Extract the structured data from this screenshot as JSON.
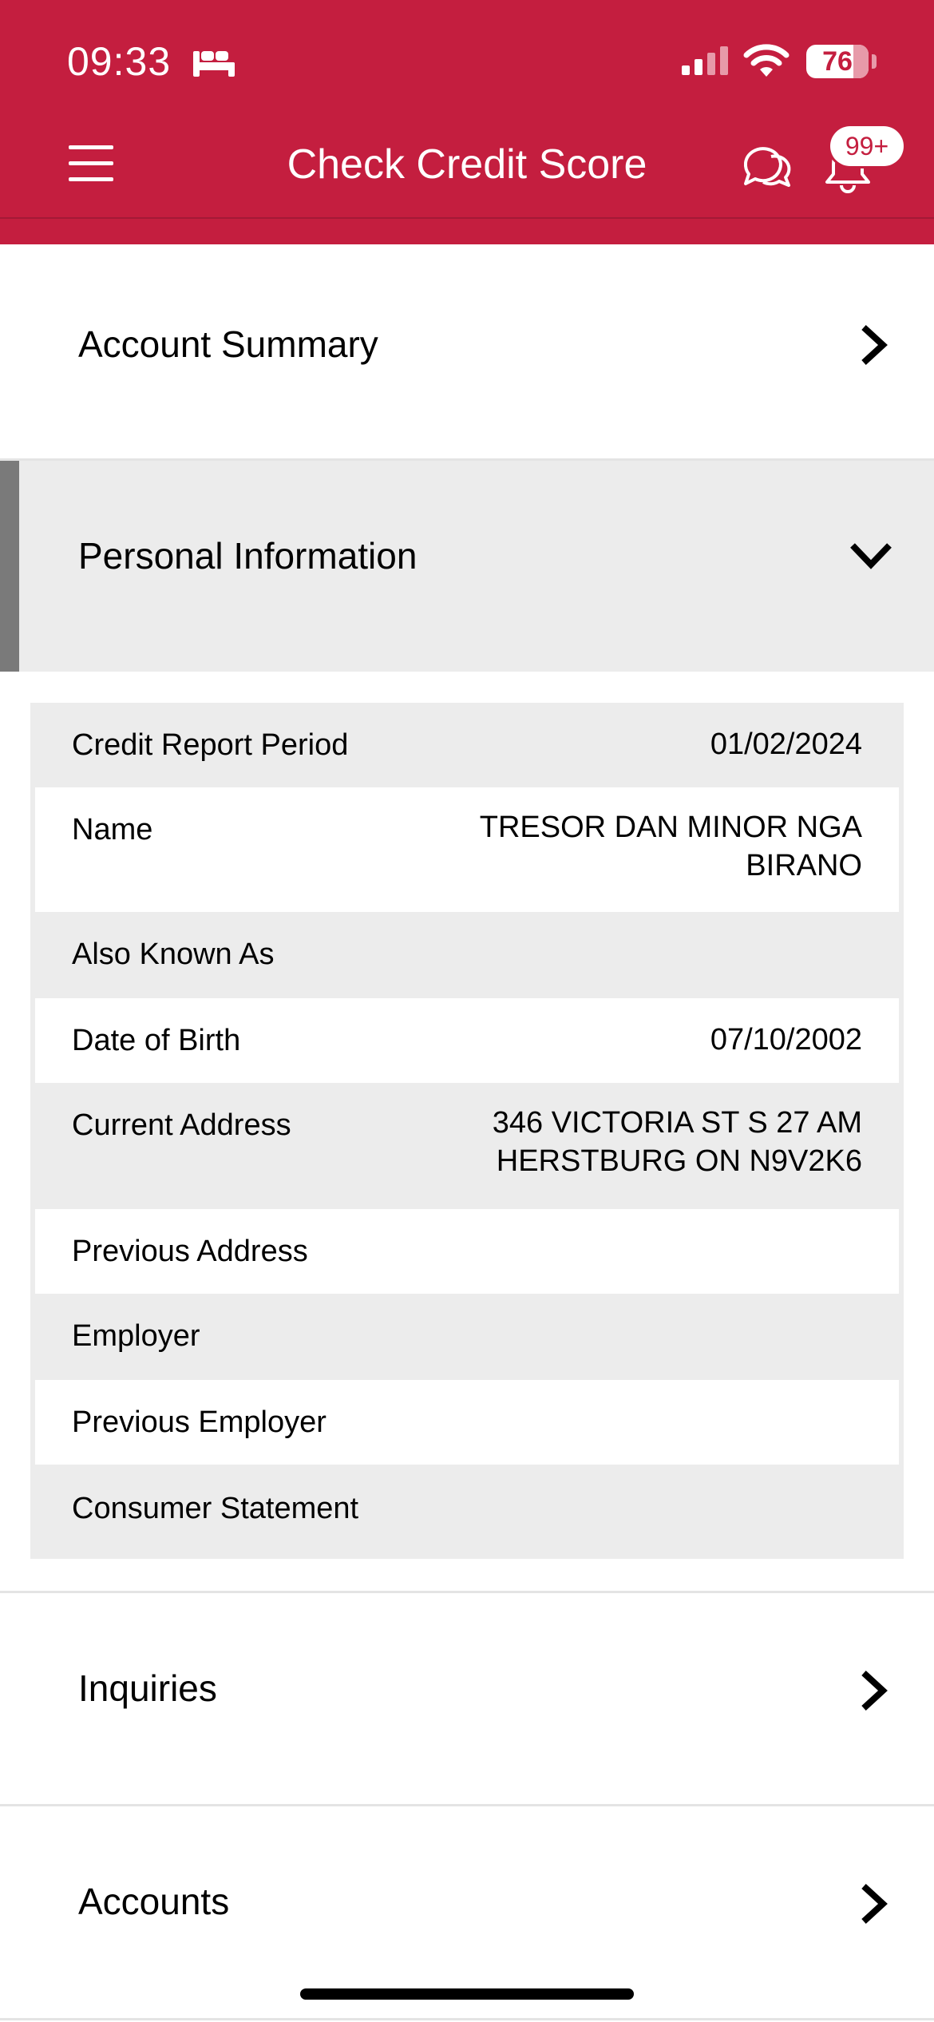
{
  "status_bar": {
    "time": "09:33",
    "battery": "76",
    "battery_level_percent": 76
  },
  "header": {
    "title": "Check Credit Score",
    "notification_badge": "99+"
  },
  "sections": {
    "account_summary": "Account Summary",
    "personal_information": "Personal Information",
    "inquiries": "Inquiries",
    "accounts": "Accounts"
  },
  "personal_info": {
    "rows": [
      {
        "label": "Credit Report Period",
        "value": "01/02/2024"
      },
      {
        "label": "Name",
        "value_line1": "TRESOR DAN MINOR NGA",
        "value_line2": "BIRANO"
      },
      {
        "label": "Also Known As",
        "value": ""
      },
      {
        "label": "Date of Birth",
        "value": "07/10/2002"
      },
      {
        "label": "Current Address",
        "value_line1": "346 VICTORIA ST S 27 AM",
        "value_line2": "HERSTBURG ON N9V2K6"
      },
      {
        "label": "Previous Address",
        "value": ""
      },
      {
        "label": "Employer",
        "value": ""
      },
      {
        "label": "Previous Employer",
        "value": ""
      },
      {
        "label": "Consumer Statement",
        "value": ""
      }
    ]
  },
  "colors": {
    "brand_red": "#c41e3f",
    "row_gray": "#ececec"
  },
  "icons": [
    "bed-icon",
    "signal-icon",
    "wifi-icon",
    "battery-icon",
    "menu-icon",
    "chat-icon",
    "bell-icon",
    "chevron-right-icon",
    "chevron-down-icon"
  ]
}
